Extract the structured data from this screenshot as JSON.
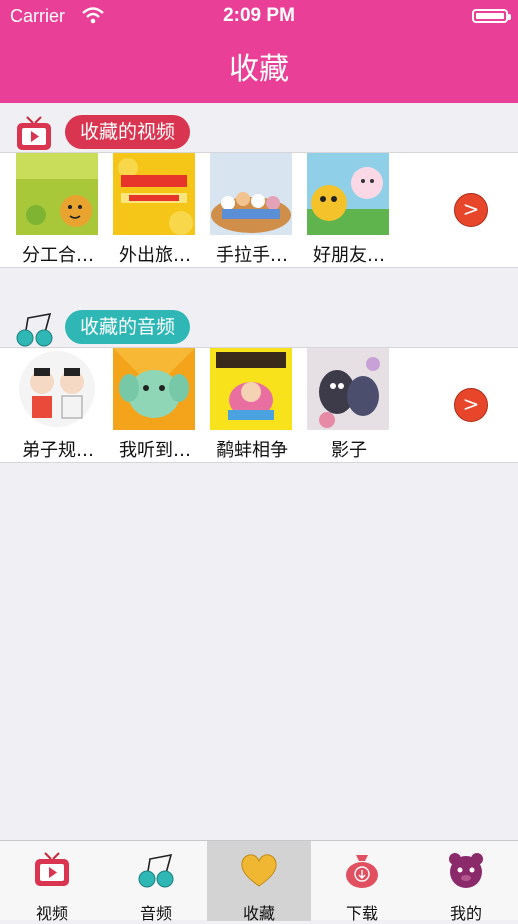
{
  "status_bar": {
    "carrier": "Carrier",
    "time": "2:09 PM"
  },
  "nav": {
    "title": "收藏"
  },
  "sections": {
    "video": {
      "label": "收藏的视频",
      "items": [
        {
          "caption": "分工合…"
        },
        {
          "caption": "外出旅…"
        },
        {
          "caption": "手拉手…"
        },
        {
          "caption": "好朋友…"
        }
      ],
      "more": ">"
    },
    "audio": {
      "label": "收藏的音频",
      "items": [
        {
          "caption": "弟子规…"
        },
        {
          "caption": "我听到…"
        },
        {
          "caption": "鹬蚌相争"
        },
        {
          "caption": "影子"
        }
      ],
      "more": ">"
    }
  },
  "tabs": [
    {
      "label": "视频",
      "icon": "tv-icon"
    },
    {
      "label": "音频",
      "icon": "music-note-icon"
    },
    {
      "label": "收藏",
      "icon": "heart-icon",
      "active": true
    },
    {
      "label": "下载",
      "icon": "download-bag-icon"
    },
    {
      "label": "我的",
      "icon": "bear-face-icon"
    }
  ],
  "colors": {
    "nav": "#ea3f96",
    "video_pill": "#d93450",
    "audio_pill": "#2fb7b6",
    "more_button": "#e8462a"
  }
}
